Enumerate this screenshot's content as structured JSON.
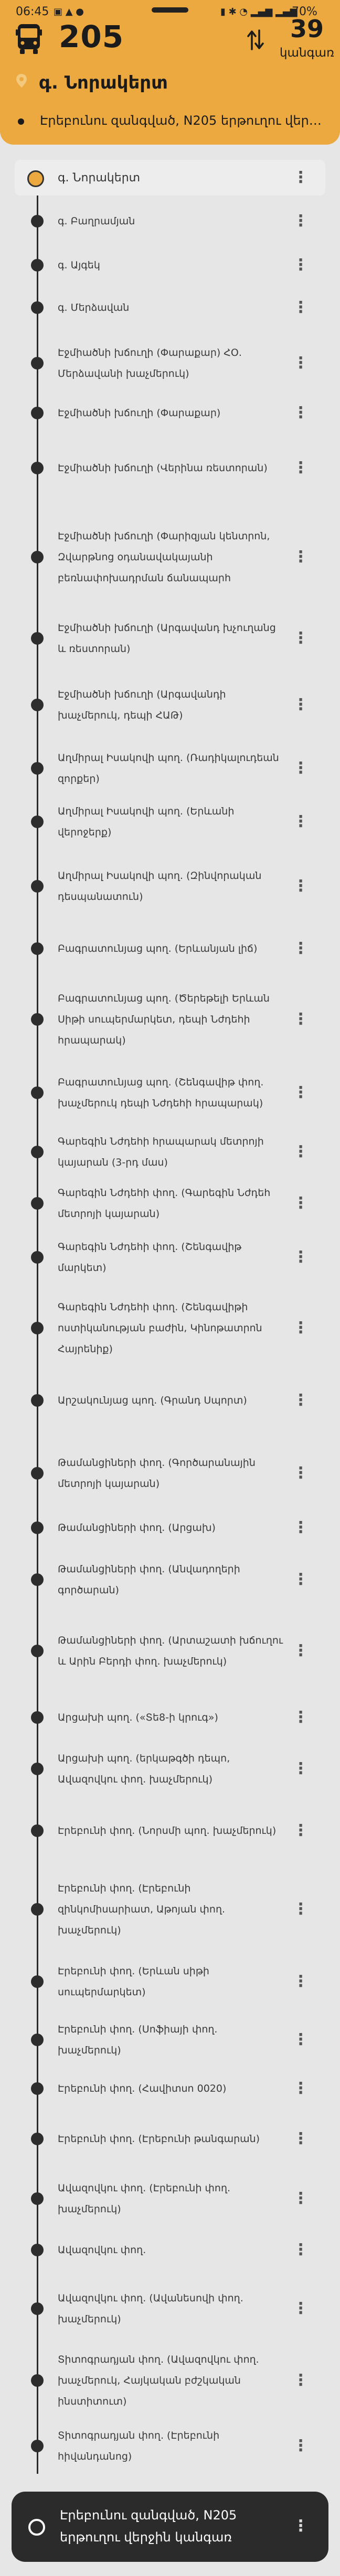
{
  "status_bar": {
    "time": "06:45",
    "battery": "70%"
  },
  "header": {
    "route_number": "205",
    "stop_count": "39",
    "stop_count_unit": "կանգառ",
    "search_value": "գ. Նորակերտ",
    "direction": "Էրեբունու զանգված, N205 երթուղու վերջի...",
    "icons": [
      "bus-icon",
      "swap-direction-icon",
      "location-pin-icon"
    ],
    "accent_color": "#eca940"
  },
  "stops": [
    {
      "name": "գ. Նորակերտ"
    },
    {
      "name": "գ. Բաղրամյան"
    },
    {
      "name": "գ. Այգեկ"
    },
    {
      "name": "գ. Մերձավան"
    },
    {
      "name": "Էջմիածնի խճուղի (Փարաքար) ՀՕ. Մերձավանի խաչմերուկ)"
    },
    {
      "name": "Էջմիածնի խճուղի (Փարաքար)"
    },
    {
      "name": "Էջմիածնի խճուղի (Վերինա ռեստորան)"
    },
    {
      "name": "Էջմիածնի խճուղի (Փարիզյան կենտրոն, Զվարթնոց օդանավակայանի բեռնափոխադրման ճանապարհ"
    },
    {
      "name": "Էջմիածնի խճուղի (Արգավանդ խչուղանց և ռեստորան)"
    },
    {
      "name": "Էջմիածնի խճուղի (Արգավանդի խաչմերուկ, դեպի ՀԱԹ)"
    },
    {
      "name": "Աղմիրալ Իսակովի պող. (Ռադիկալուդեան զորքեր)"
    },
    {
      "name": "Աղմիրալ Իսակովի պող. (Երևանի վերոջերք)"
    },
    {
      "name": "Աղմիրալ Իսակովի պող. (Զինվորական դեսպանատուն)"
    },
    {
      "name": "Բագրատունյաց պող. (Երևանյան լիճ)"
    },
    {
      "name": "Բագրատունյաց պող. (Ծերեթելի Երևան Սիթի սուպերմարկետ, դեպի Նժդեհի հրապարակ)"
    },
    {
      "name": "Բագրատունյաց պող. (Շենգավիթ փող. խաչմերուկ դեպի Նժդեհի հրապարակ)"
    },
    {
      "name": "Գարեգին Նժդեհի հրապարակ մետրոյի կայարան (3-րդ մաս)"
    },
    {
      "name": "Գարեգին Նժդեհի փող. (Գարեգին Նժդեհ մետրոյի կայարան)"
    },
    {
      "name": "Գարեգին Նժդեհի փող. (Շենգավիթ մարկետ)"
    },
    {
      "name": "Գարեգին Նժդեհի փող. (Շենգավիթի ոստիկանության բաժին, Կինոթատրոն Հայրենիք)"
    },
    {
      "name": "Արշակունյաց պող. (Գրանդ Սպորտ)"
    },
    {
      "name": "Թամանցիների փող. (Գործարանային մետրոյի կայարան)"
    },
    {
      "name": "Թամանցիների փող. (Արցախ)"
    },
    {
      "name": "Թամանցիների փող. (Անվադողերի գործարան)"
    },
    {
      "name": "Թամանցիների փող. (Արտաշատի խճուղու և Արին Բերդի փող. խաչմերուկ)"
    },
    {
      "name": "Արցախի պող. («Տե8-ի կրուգ»)"
    },
    {
      "name": "Արցախի պող. (երկաթգծի դեպո, Ավազովկու փող. խաչմերուկ)"
    },
    {
      "name": "Էրեբունի փող. (Նորսմի պող. խաչմերուկ)"
    },
    {
      "name": "Էրեբունի փող. (Էրեբունի զինկոմիսարիատ, Աթոյան փող. խաչմերուկ)"
    },
    {
      "name": "Էրեբունի փող. (Երևան սիթի սուպերմարկետ)"
    },
    {
      "name": "Էրեբունի փող. (Սոֆիայի փող. խաչմերուկ)"
    },
    {
      "name": "Էրեբունի փող. (Հավիտսո 0020)"
    },
    {
      "name": "Էրեբունի փող. (Էրեբունի թանգարան)"
    },
    {
      "name": "Ավազովկու փող. (Էրեբունի փող. խաչմերուկ)"
    },
    {
      "name": "Ավազովկու փող."
    },
    {
      "name": "Ավազովկու փող. (Ավանեսովի փող. խաչմերուկ)"
    },
    {
      "name": "Տիտոգրադյան փող. (Ավազովկու փող. խաչմերուկ, Հայկական բժշկական ինստիտուտ)"
    },
    {
      "name": "Տիտոգրադյան փող. (Էրեբունի հիվանդանոց)"
    },
    {
      "name": "Էրեբունու զանգված, N205 երթուղու վերջին կանգառ"
    }
  ]
}
